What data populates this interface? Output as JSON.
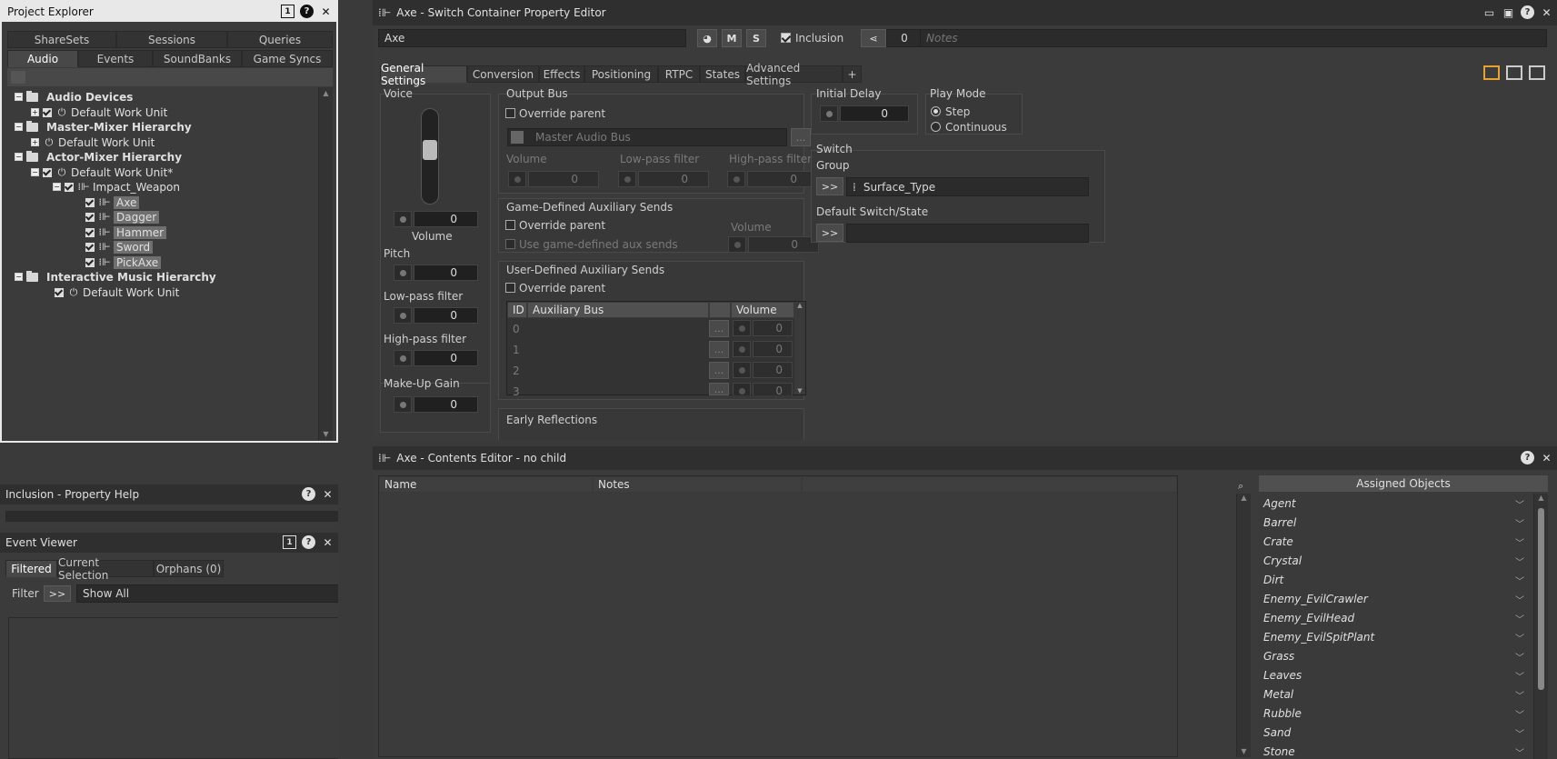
{
  "project_explorer": {
    "title": "Project Explorer",
    "tabs_row1": [
      "ShareSets",
      "Sessions",
      "Queries"
    ],
    "tabs_row2": [
      "Audio",
      "Events",
      "SoundBanks",
      "Game Syncs"
    ],
    "tree": [
      {
        "label": "Audio Devices",
        "bold": true
      },
      {
        "label": "Default Work Unit"
      },
      {
        "label": "Master-Mixer Hierarchy",
        "bold": true
      },
      {
        "label": "Default Work Unit"
      },
      {
        "label": "Actor-Mixer Hierarchy",
        "bold": true
      },
      {
        "label": "Default Work Unit*"
      },
      {
        "label": "Impact_Weapon"
      },
      {
        "label": "Axe"
      },
      {
        "label": "Dagger"
      },
      {
        "label": "Hammer"
      },
      {
        "label": "Sword"
      },
      {
        "label": "PickAxe"
      },
      {
        "label": "Interactive Music Hierarchy",
        "bold": true
      },
      {
        "label": "Default Work Unit"
      }
    ]
  },
  "property_help": {
    "title": "Inclusion - Property Help"
  },
  "event_viewer": {
    "title": "Event Viewer",
    "tabs": [
      "Filtered",
      "Current Selection",
      "Orphans (0)"
    ],
    "filter_label": "Filter",
    "filter_button": ">>",
    "filter_value": "Show All"
  },
  "property_editor": {
    "title": "Axe - Switch Container Property Editor",
    "name_value": "Axe",
    "m_label": "M",
    "s_label": "S",
    "inclusion_label": "Inclusion",
    "share_count": "0",
    "notes_placeholder": "Notes",
    "tabs": [
      "General Settings",
      "Conversion",
      "Effects",
      "Positioning",
      "RTPC",
      "States",
      "Advanced Settings",
      "+"
    ],
    "voice": {
      "title": "Voice",
      "volume_label": "Volume",
      "volume": "0",
      "pitch_label": "Pitch",
      "pitch": "0",
      "lpf_label": "Low-pass filter",
      "lpf": "0",
      "hpf_label": "High-pass filter",
      "hpf": "0",
      "makeup_label": "Make-Up Gain",
      "makeup": "0"
    },
    "output_bus": {
      "title": "Output Bus",
      "override_label": "Override parent",
      "bus_value": "Master Audio Bus",
      "browse": "...",
      "volume_label": "Volume",
      "volume": "0",
      "lpf_label": "Low-pass filter",
      "lpf": "0",
      "hpf_label": "High-pass filter",
      "hpf": "0"
    },
    "game_aux": {
      "title": "Game-Defined Auxiliary Sends",
      "override_label": "Override parent",
      "use_label": "Use game-defined aux sends",
      "volume_label": "Volume",
      "volume": "0"
    },
    "user_aux": {
      "title": "User-Defined Auxiliary Sends",
      "override_label": "Override parent",
      "headers": [
        "ID",
        "Auxiliary Bus",
        "Volume"
      ],
      "rows": [
        {
          "id": "0",
          "browse": "...",
          "volume": "0"
        },
        {
          "id": "1",
          "browse": "...",
          "volume": "0"
        },
        {
          "id": "2",
          "browse": "...",
          "volume": "0"
        },
        {
          "id": "3",
          "browse": "...",
          "volume": "0"
        }
      ]
    },
    "early_reflections": {
      "title": "Early Reflections"
    },
    "initial_delay": {
      "title": "Initial Delay",
      "value": "0"
    },
    "play_mode": {
      "title": "Play Mode",
      "options": [
        "Step",
        "Continuous"
      ],
      "selected": "Step"
    },
    "switch": {
      "title": "Switch",
      "group_label": "Group",
      "group_button": ">>",
      "group_value": "Surface_Type",
      "default_label": "Default Switch/State",
      "default_button": ">>",
      "default_value": ""
    }
  },
  "contents_editor": {
    "title": "Axe - Contents Editor - no child",
    "columns": [
      "Name",
      "Notes"
    ],
    "assigned_title": "Assigned Objects",
    "assigned": [
      "Agent",
      "Barrel",
      "Crate",
      "Crystal",
      "Dirt",
      "Enemy_EvilCrawler",
      "Enemy_EvilHead",
      "Enemy_EvilSpitPlant",
      "Grass",
      "Leaves",
      "Metal",
      "Rubble",
      "Sand",
      "Stone"
    ]
  }
}
